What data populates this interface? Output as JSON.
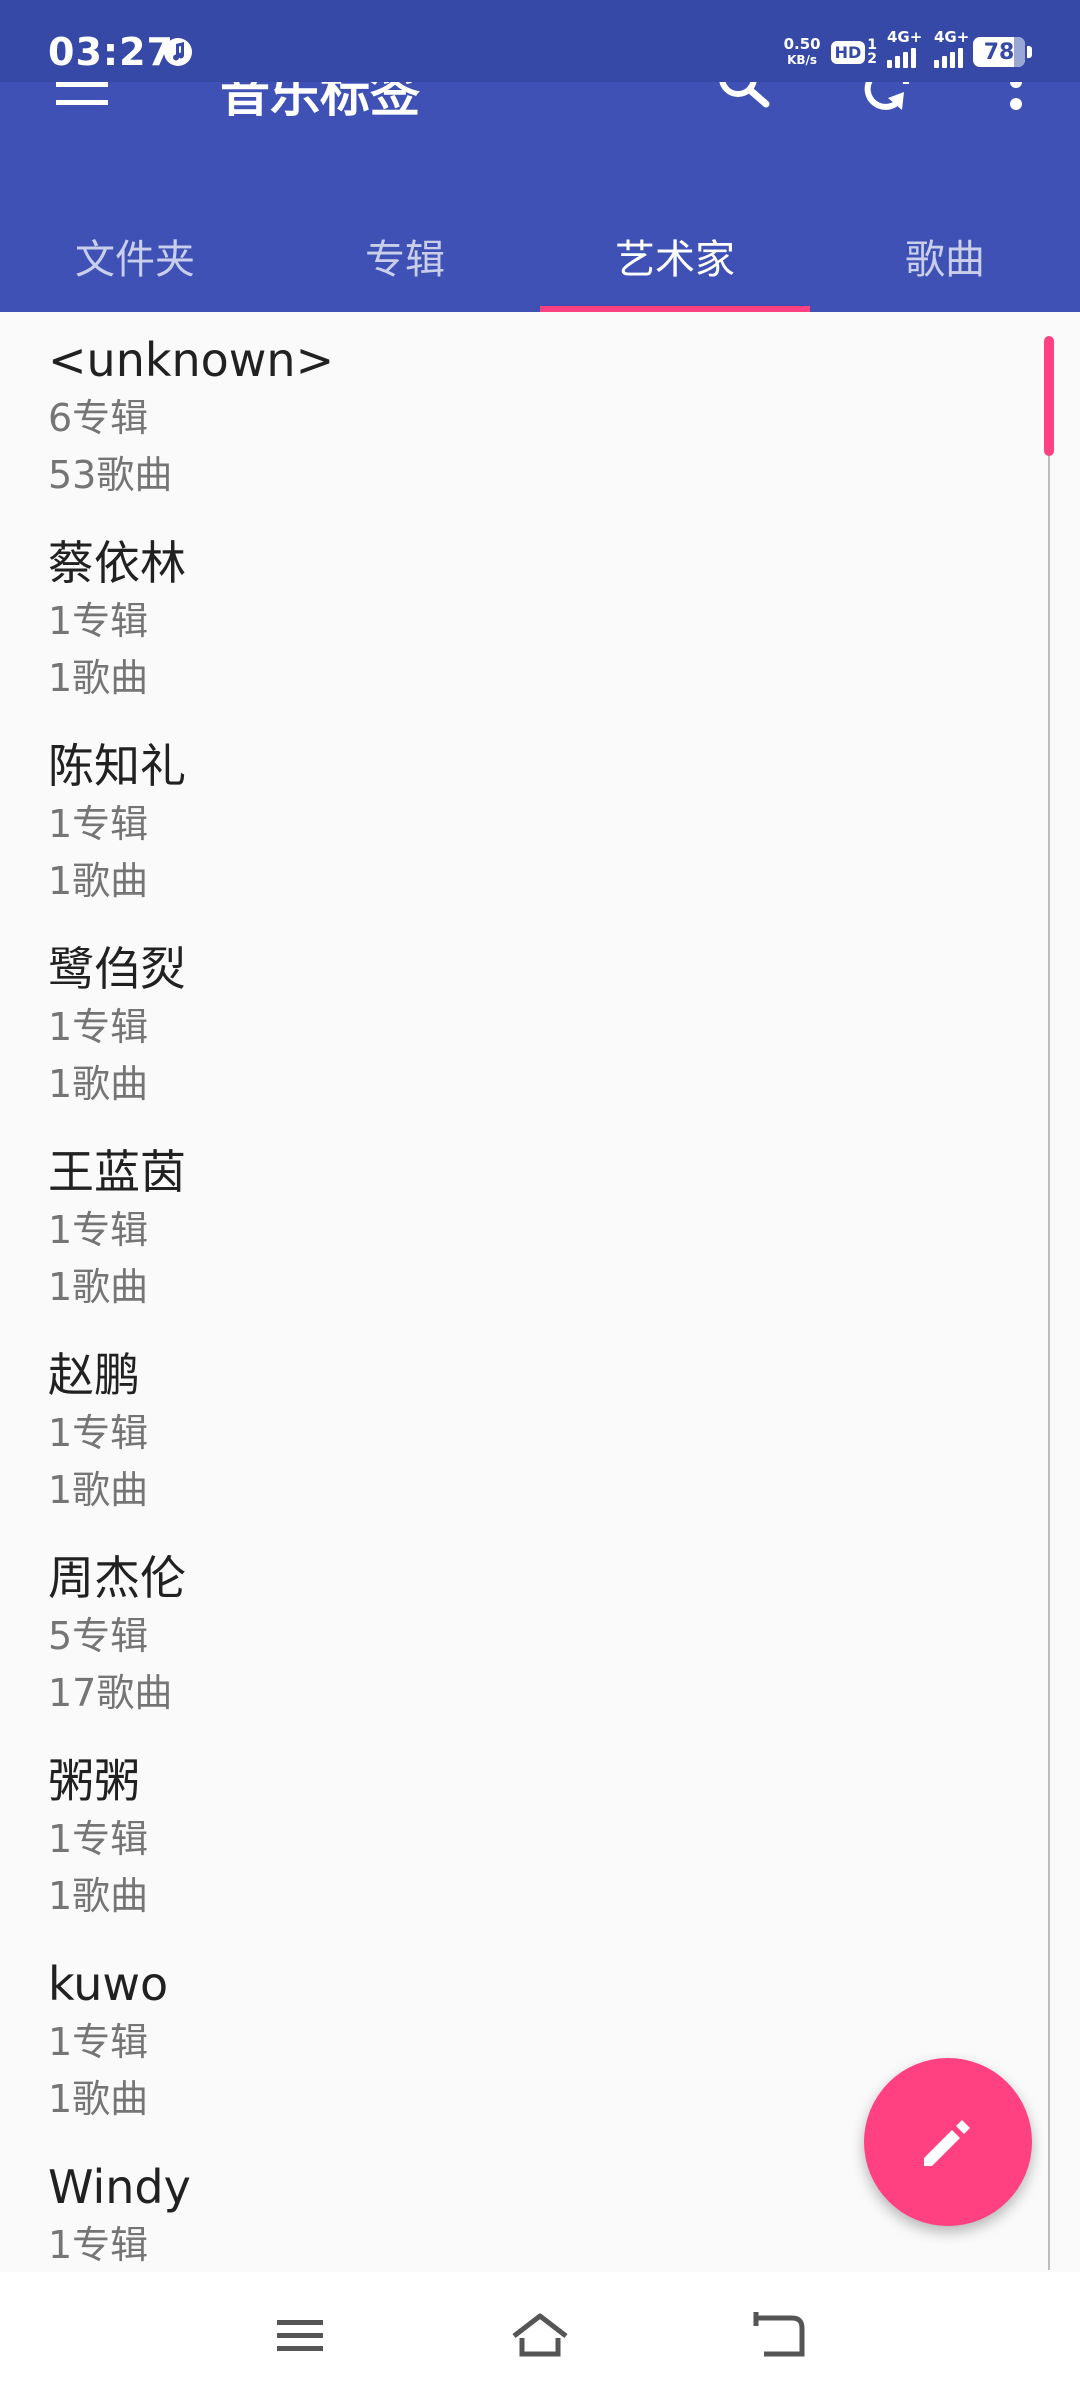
{
  "status_bar": {
    "time": "03:27",
    "net_speed_value": "0.50",
    "net_speed_unit": "KB/s",
    "hd_label": "HD",
    "hd_sim": "1",
    "hd_sub": "2",
    "signal1_label": "4G+",
    "signal2_label": "4G+",
    "battery": "78",
    "icons": [
      "music-note-icon",
      "hd-icon",
      "signal-icon",
      "battery-icon"
    ]
  },
  "app_bar": {
    "title": "音乐标签",
    "icons": [
      "menu-icon",
      "search-icon",
      "refresh-icon",
      "more-vert-icon"
    ],
    "tabs": [
      {
        "label": "文件夹"
      },
      {
        "label": "专辑"
      },
      {
        "label": "艺术家"
      },
      {
        "label": "歌曲"
      }
    ],
    "active_tab": "艺术家",
    "accent_color": "#ff4081",
    "primary_color": "#3f51b5"
  },
  "artists": [
    {
      "name": "<unknown>",
      "albums": "6专辑",
      "songs": "53歌曲"
    },
    {
      "name": "蔡依林",
      "albums": "1专辑",
      "songs": "1歌曲"
    },
    {
      "name": "陈知礼",
      "albums": "1专辑",
      "songs": "1歌曲"
    },
    {
      "name": "鹭㑇烮",
      "albums": "1专辑",
      "songs": "1歌曲"
    },
    {
      "name": "王蓝茵",
      "albums": "1专辑",
      "songs": "1歌曲"
    },
    {
      "name": "赵鹏",
      "albums": "1专辑",
      "songs": "1歌曲"
    },
    {
      "name": "周杰伦",
      "albums": "5专辑",
      "songs": "17歌曲"
    },
    {
      "name": "粥粥",
      "albums": "1专辑",
      "songs": "1歌曲"
    },
    {
      "name": "kuwo",
      "albums": "1专辑",
      "songs": "1歌曲"
    },
    {
      "name": "Windy",
      "albums": "1专辑",
      "songs": ""
    }
  ],
  "fab": {
    "icon": "edit-pencil-icon"
  },
  "nav_bar": {
    "icons": [
      "nav-menu-icon",
      "nav-home-icon",
      "nav-back-icon"
    ]
  }
}
